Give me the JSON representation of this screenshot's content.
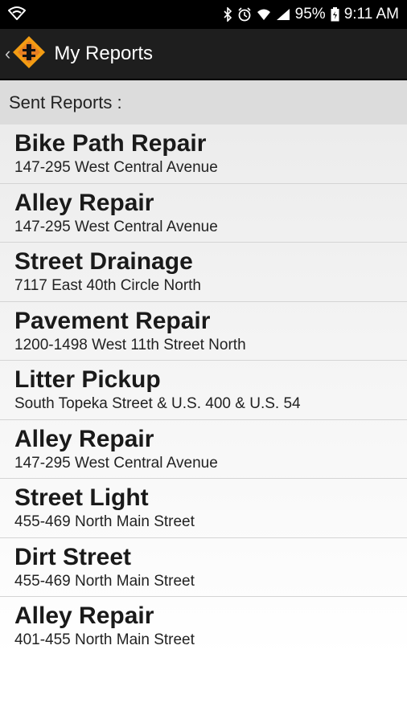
{
  "status_bar": {
    "battery": "95%",
    "time": "9:11 AM"
  },
  "header": {
    "title": "My Reports",
    "back_icon": "chevron-left-icon",
    "logo_icon": "orange-diamond-logo-icon"
  },
  "section": {
    "label": "Sent Reports :"
  },
  "reports": [
    {
      "title": "Bike Path Repair",
      "address": "147-295 West Central Avenue"
    },
    {
      "title": "Alley Repair",
      "address": "147-295 West Central Avenue"
    },
    {
      "title": "Street Drainage",
      "address": "7117 East 40th Circle North"
    },
    {
      "title": "Pavement Repair",
      "address": "1200-1498 West 11th Street North"
    },
    {
      "title": "Litter Pickup",
      "address": "South Topeka Street & U.S. 400 & U.S. 54"
    },
    {
      "title": "Alley Repair",
      "address": "147-295 West Central Avenue"
    },
    {
      "title": "Street Light",
      "address": "455-469 North Main Street"
    },
    {
      "title": "Dirt Street",
      "address": "455-469 North Main Street"
    },
    {
      "title": "Alley Repair",
      "address": "401-455 North Main Street"
    }
  ],
  "colors": {
    "accent": "#f39c12",
    "action_bar": "#1e1e1e",
    "section_bg": "#dcdcdc"
  }
}
